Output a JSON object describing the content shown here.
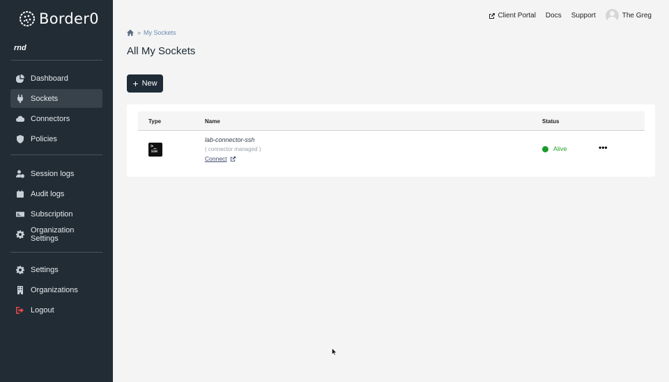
{
  "brand": {
    "name": "Border0"
  },
  "org": {
    "name": "rnd"
  },
  "sidebar": {
    "items": [
      {
        "label": "Dashboard",
        "icon": "pie-chart-icon"
      },
      {
        "label": "Sockets",
        "icon": "plug-icon"
      },
      {
        "label": "Connectors",
        "icon": "cloud-icon"
      },
      {
        "label": "Policies",
        "icon": "shield-icon"
      },
      {
        "label": "Session logs",
        "icon": "user-clock-icon"
      },
      {
        "label": "Audit logs",
        "icon": "calendar-icon"
      },
      {
        "label": "Subscription",
        "icon": "card-icon"
      },
      {
        "label": "Organization Settings",
        "icon": "gear-icon"
      },
      {
        "label": "Settings",
        "icon": "gear-icon"
      },
      {
        "label": "Organizations",
        "icon": "building-icon"
      },
      {
        "label": "Logout",
        "icon": "logout-icon"
      }
    ],
    "active": "Sockets"
  },
  "topbar": {
    "client_portal": "Client Portal",
    "docs": "Docs",
    "support": "Support",
    "user": "The Greg"
  },
  "breadcrumb": {
    "separator": "»",
    "current": "My Sockets"
  },
  "page": {
    "title": "All My Sockets",
    "new_button": "New",
    "new_symbol": "+"
  },
  "table": {
    "headers": {
      "type": "Type",
      "name": "Name",
      "status": "Status"
    },
    "rows": [
      {
        "type_label": "SSH",
        "type_prompt": ">_",
        "name": "lab-connector-ssh",
        "managed": "( connector managed )",
        "connect": "Connect",
        "status": "Alive",
        "status_color": "#1c9b27",
        "menu": "•••"
      }
    ]
  },
  "colors": {
    "sidebar_bg": "#222c35",
    "primary_button": "#1f2b37",
    "status_alive": "#1c9b27",
    "logout_icon": "#e5484d"
  }
}
